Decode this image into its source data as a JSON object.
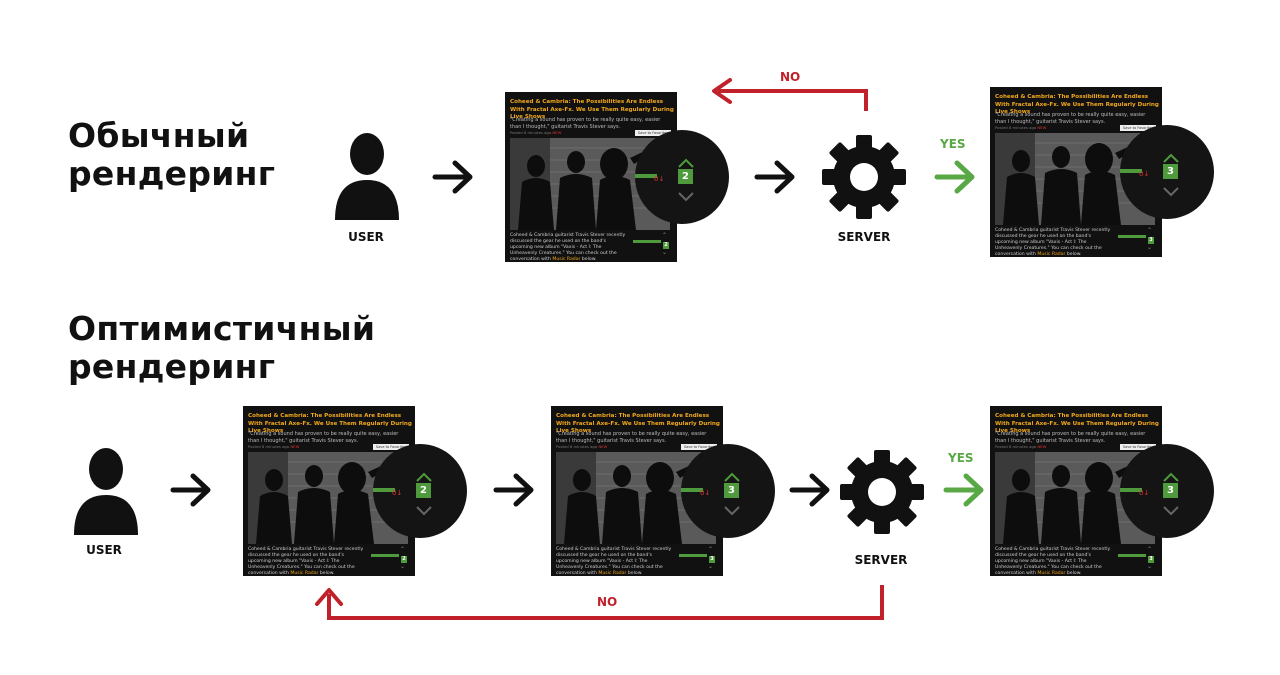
{
  "sections": {
    "regular_title": "Обычный\nрендеринг",
    "optimistic_title": "Оптимистичный\nрендеринг"
  },
  "labels": {
    "user": "USER",
    "server": "SERVER",
    "yes": "YES",
    "no": "NO"
  },
  "card": {
    "title": "Coheed & Cambria: The Possibilities Are Endless With Fractal Axe-Fx. We Use Them Regularly During Live Shows",
    "quote": "\"Creating a sound has proven to be really quite easy, easier than I thought,\" guitarist Travis Stever says.",
    "posted": "Posted 8 minutes ago",
    "posted_tag": "NEW",
    "save": "Save to Favorites",
    "body": "Coheed & Cambria guitarist Travis Stever recently discussed the gear he used on the band's upcoming new album \"Vaxis - Act I: The Unheavenly Creatures.\" You can check out the conversation with",
    "body_link": "Music Radar",
    "body_end": "below.",
    "zero": "0↓"
  },
  "votes": {
    "regular_before": "2",
    "regular_after": "3",
    "optimistic_before": "2",
    "optimistic_mid": "3",
    "optimistic_after": "3"
  },
  "colors": {
    "accent_green": "#5aa845",
    "reject_red": "#c0212b",
    "card_bg": "#111111",
    "headline_orange": "#f2a81d"
  }
}
